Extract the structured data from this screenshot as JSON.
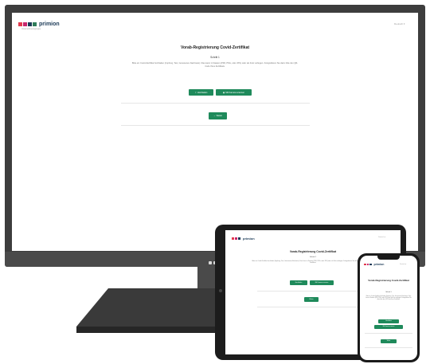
{
  "brand": {
    "name": "primion",
    "tagline": "Unternehmensgruppe",
    "colors": [
      "#e23a4e",
      "#c8266d",
      "#1b3a57",
      "#2f7d5a"
    ]
  },
  "language_selector": "Deutsch ▾",
  "page": {
    "title": "Vorab-Registrierung Covid-Zertifikat",
    "step": "Schritt 1",
    "instructions": "Bitte ein Covid-Zertifikat hochladen (Impfung, Test, Genesenen-Nachweis). Dies kann in Dateien (PDF, PNG, oder JPG) oder als Foto vorliegen. Fotografieren Sie dazu bitte den QR-Code Ihres Zertifikats.",
    "buttons": {
      "upload": "Hochladen",
      "photo": "Mit Kamera scannen",
      "continue": "Weiter"
    }
  },
  "accent_color": "#1f8a5b"
}
